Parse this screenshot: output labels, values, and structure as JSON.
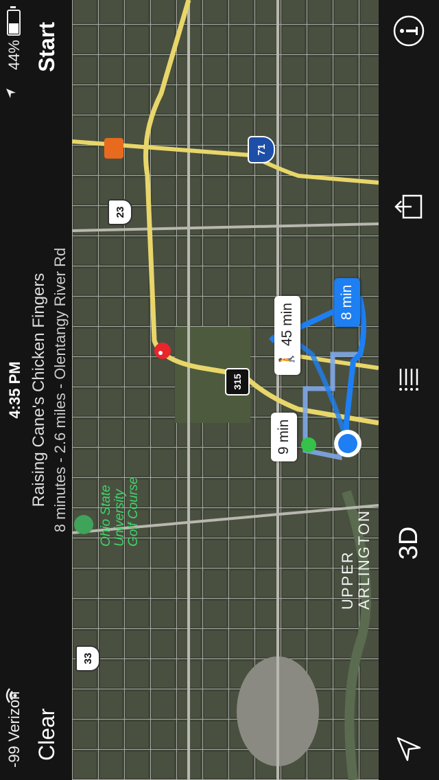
{
  "status_bar": {
    "carrier": "-99 Verizon",
    "time": "4:35 PM",
    "battery_percent": "44%",
    "battery_level": 0.44
  },
  "nav": {
    "clear_label": "Clear",
    "start_label": "Start",
    "destination_name": "Raising Cane's Chicken Fingers",
    "route_summary": "8 minutes - 2.6 miles - Olentangy River Rd"
  },
  "map": {
    "callouts": {
      "walk": "45 min",
      "alt_route": "9 min",
      "primary_route": "8 min"
    },
    "labels": {
      "golf_course_line1": "Ohio State",
      "golf_course_line2": "University",
      "golf_course_line3": "Golf Course",
      "neighborhood_line1": "UPPER",
      "neighborhood_line2": "ARLINGTON"
    },
    "shields": {
      "us_33": "33",
      "us_23": "23",
      "sr_315": "315",
      "i_71": "71"
    },
    "colors": {
      "route_primary": "#1e7ff2",
      "route_alt": "#7fa7e8",
      "highway": "#e8d66a",
      "start_pin": "#35c24a",
      "destination_pin": "#e8262c"
    }
  },
  "toolbar": {
    "three_d_label": "3D",
    "locate_icon": "location-arrow-icon",
    "list_icon": "list-icon",
    "share_icon": "share-icon",
    "info_icon": "info-icon"
  }
}
